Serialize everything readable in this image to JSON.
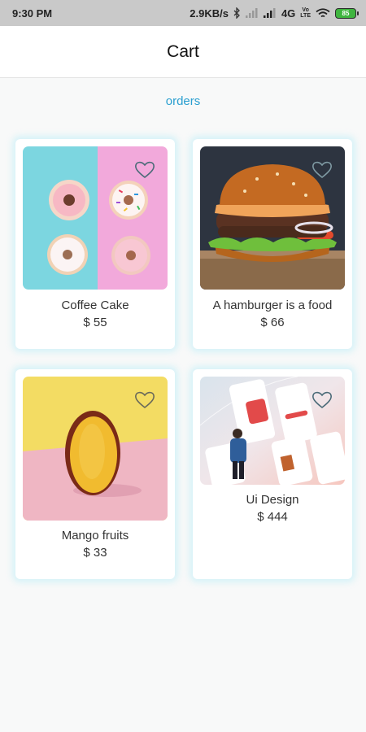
{
  "status_bar": {
    "time": "9:30 PM",
    "speed": "2.9KB/s",
    "network": "4G",
    "volte_top": "Vo",
    "volte_bottom": "LTE",
    "battery": "85"
  },
  "header": {
    "title": "Cart"
  },
  "orders_link": "orders",
  "products": [
    {
      "name": "Coffee Cake",
      "price": "$ 55",
      "image": "donuts-photo"
    },
    {
      "name": "A hamburger is a food",
      "price": "$ 66",
      "image": "hamburger-photo"
    },
    {
      "name": "Mango fruits",
      "price": "$ 33",
      "image": "mango-photo"
    },
    {
      "name": "Ui Design",
      "price": "$ 444",
      "image": "ui-design-mockup"
    }
  ],
  "colors": {
    "accent": "#2a9fd0",
    "background": "#f8f9f9",
    "card_glow": "#c8f0f8"
  }
}
